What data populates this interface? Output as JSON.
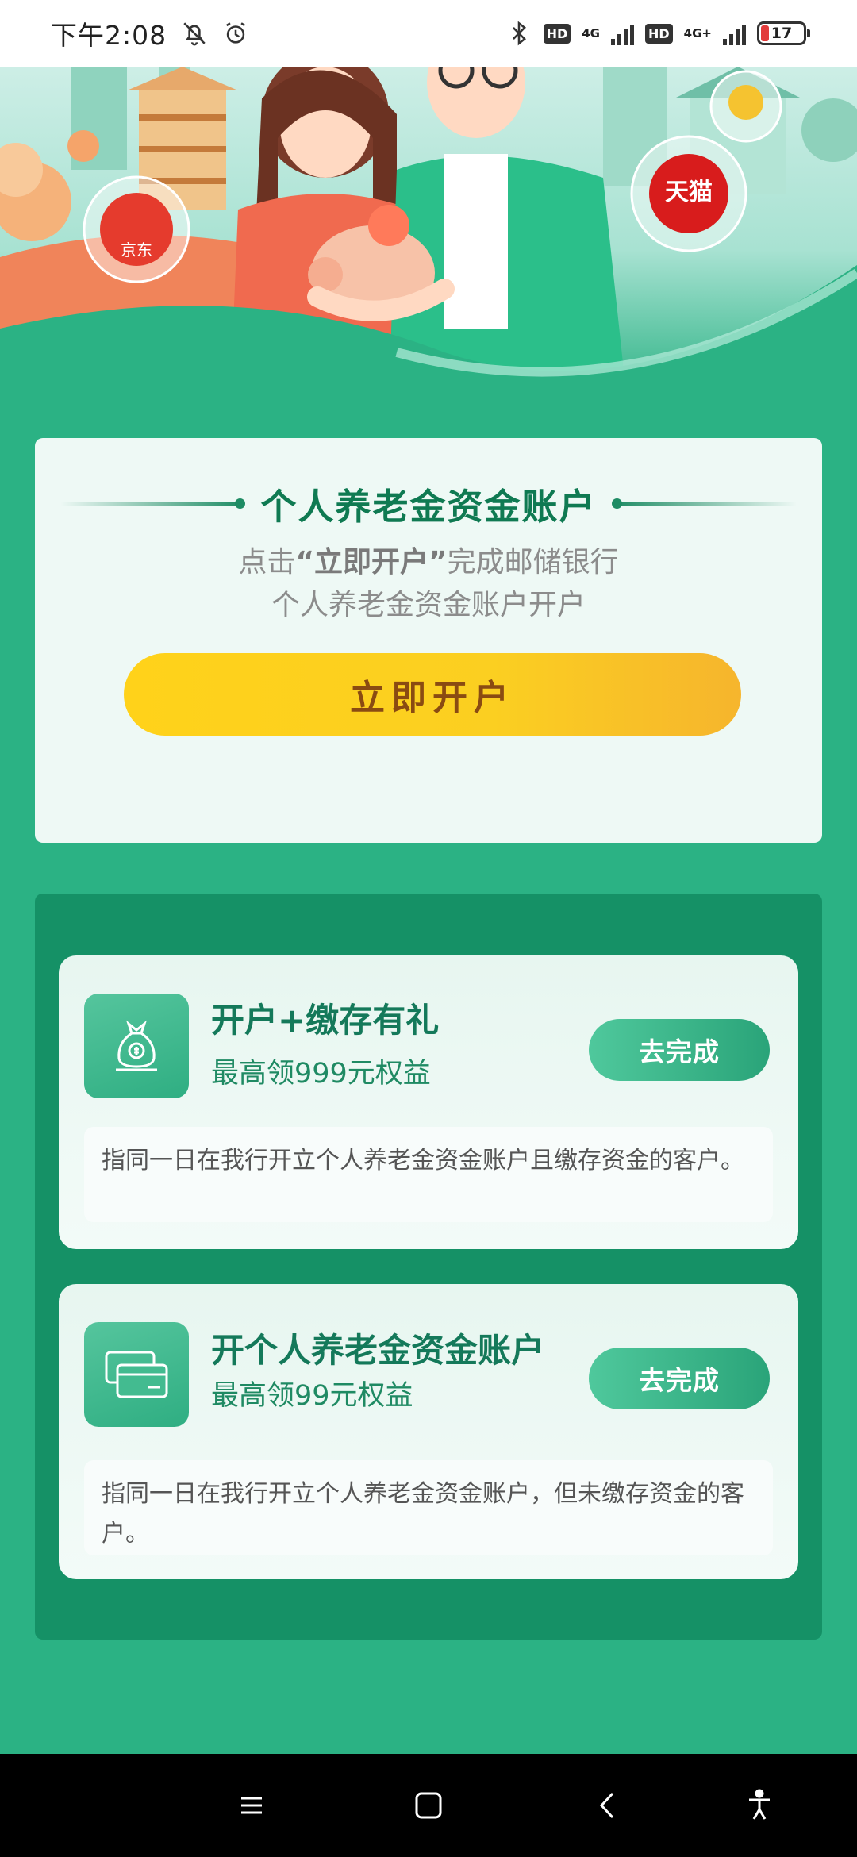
{
  "status_bar": {
    "time": "下午2:08",
    "network_1": "4G",
    "network_2": "4G+",
    "hd": "HD",
    "battery": "17"
  },
  "banner": {
    "badge_left": "京东",
    "badge_right": "天猫"
  },
  "account": {
    "title": "个人养老金资金账户",
    "desc_prefix": "点击",
    "desc_highlight": "“立即开户”",
    "desc_line1_suffix": "完成邮储银行",
    "desc_line2": "个人养老金资金账户开户",
    "open_button": "立即开户"
  },
  "tasks": [
    {
      "title": "开户+缴存有礼",
      "subtitle": "最高领999元权益",
      "button": "去完成",
      "note": "指同一日在我行开立个人养老金资金账户且缴存资金的客户。"
    },
    {
      "title": "开个人养老金资金账户",
      "subtitle": "最高领99元权益",
      "button": "去完成",
      "note": "指同一日在我行开立个人养老金资金账户，但未缴存资金的客户。"
    }
  ],
  "colors": {
    "page_bg": "#2bb284",
    "panel_bg": "#159166",
    "accent_green": "#14795a",
    "button_yellow": "#ffd21a"
  },
  "icons": [
    "bell-off-icon",
    "alarm-icon",
    "bluetooth-icon",
    "signal-icon",
    "battery-icon",
    "money-bag-icon",
    "cards-icon",
    "menu-icon",
    "home-icon",
    "back-icon",
    "accessibility-icon"
  ]
}
